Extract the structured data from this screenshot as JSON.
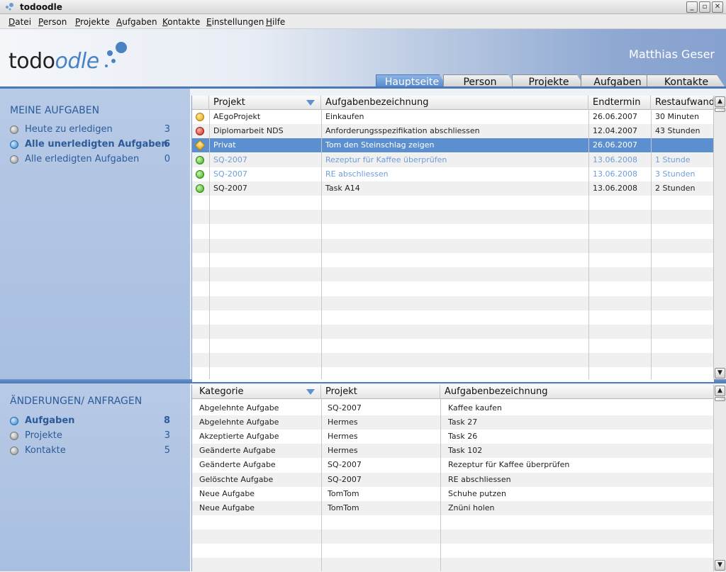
{
  "window": {
    "title": "todoodle",
    "buttons": {
      "minimize": "_",
      "restore": "▫",
      "close": "✕"
    }
  },
  "menu": [
    {
      "u": "D",
      "rest": "atei"
    },
    {
      "u": "P",
      "rest": "erson"
    },
    {
      "u": "P",
      "rest": "rojekte"
    },
    {
      "u": "A",
      "rest": "ufgaben"
    },
    {
      "u": "K",
      "rest": "ontakte"
    },
    {
      "u": "E",
      "rest": "instellungen"
    },
    {
      "u": "H",
      "rest": "ilfe"
    }
  ],
  "header": {
    "logo_todo": "todo",
    "logo_odle": "odle",
    "user": "Matthias Geser"
  },
  "tabs": [
    "Hauptseite",
    "Person",
    "Projekte",
    "Aufgaben",
    "Kontakte"
  ],
  "sidebar_tasks": {
    "title": "MEINE AUFGABEN",
    "items": [
      {
        "label": "Heute zu erledigen",
        "count": "3"
      },
      {
        "label": "Alle unerledigten Aufgaben",
        "count": "6"
      },
      {
        "label": "Alle erledigten Aufgaben",
        "count": "0"
      }
    ]
  },
  "sidebar_changes": {
    "title": "ÄNDERUNGEN/ ANFRAGEN",
    "items": [
      {
        "label": "Aufgaben",
        "count": "8"
      },
      {
        "label": "Projekte",
        "count": "3"
      },
      {
        "label": "Kontakte",
        "count": "5"
      }
    ]
  },
  "tasks_table": {
    "headers": [
      "Projekt",
      "Aufgabenbezeichnung",
      "Endtermin",
      "Restaufwand"
    ],
    "rows": [
      {
        "status": "orange",
        "projekt": "AEgoProjekt",
        "aufgabe": "Einkaufen",
        "endtermin": "26.06.2007",
        "rest": "30 Minuten"
      },
      {
        "status": "red",
        "projekt": "Diplomarbeit NDS",
        "aufgabe": "Anforderungsspezifikation abschliessen",
        "endtermin": "12.04.2007",
        "rest": "43 Stunden"
      },
      {
        "status": "orange",
        "projekt": "Privat",
        "aufgabe": "Tom den Steinschlag zeigen",
        "endtermin": "26.06.2007",
        "rest": ""
      },
      {
        "status": "green",
        "projekt": "SQ-2007",
        "aufgabe": "Rezeptur für Kaffee überprüfen",
        "endtermin": "13.06.2008",
        "rest": "1 Stunde"
      },
      {
        "status": "green",
        "projekt": "SQ-2007",
        "aufgabe": "RE abschliessen",
        "endtermin": "13.06.2008",
        "rest": "3 Stunden"
      },
      {
        "status": "green",
        "projekt": "SQ-2007",
        "aufgabe": "Task A14",
        "endtermin": "13.06.2008",
        "rest": "2 Stunden"
      }
    ]
  },
  "changes_table": {
    "headers": [
      "Kategorie",
      "Projekt",
      "Aufgabenbezeichnung"
    ],
    "rows": [
      {
        "kategorie": "Abgelehnte Aufgabe",
        "projekt": "SQ-2007",
        "aufgabe": "Kaffee kaufen"
      },
      {
        "kategorie": "Abgelehnte Aufgabe",
        "projekt": "Hermes",
        "aufgabe": "Task 27"
      },
      {
        "kategorie": "Akzeptierte Aufgabe",
        "projekt": "Hermes",
        "aufgabe": "Task 26"
      },
      {
        "kategorie": "Geänderte Aufgabe",
        "projekt": "Hermes",
        "aufgabe": "Task 102"
      },
      {
        "kategorie": "Geänderte Aufgabe",
        "projekt": "SQ-2007",
        "aufgabe": "Rezeptur für Kaffee überprüfen"
      },
      {
        "kategorie": "Gelöschte Aufgabe",
        "projekt": "SQ-2007",
        "aufgabe": "RE abschliessen"
      },
      {
        "kategorie": "Neue Aufgabe",
        "projekt": "TomTom",
        "aufgabe": "Schuhe putzen"
      },
      {
        "kategorie": "Neue Aufgabe",
        "projekt": "TomTom",
        "aufgabe": "Znüni holen"
      }
    ]
  },
  "colors": {
    "accent": "#4d78b7",
    "selection": "#5c8fd0",
    "sidebar": "#b7cae6",
    "link_text": "#2d5b99"
  }
}
